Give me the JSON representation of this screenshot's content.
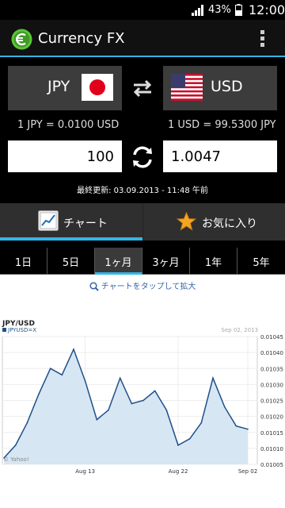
{
  "status_bar": {
    "battery_percent": "43%",
    "time": "12:00"
  },
  "action_bar": {
    "title": "Currency FX"
  },
  "converter": {
    "from_code": "JPY",
    "to_code": "USD",
    "from_rate": "1 JPY = 0.0100 USD",
    "to_rate": "1 USD = 99.5300 JPY",
    "from_amount": "100",
    "to_amount": "1.0047",
    "last_updated": "最終更新: 03.09.2013 - 11:48 午前"
  },
  "tabs": [
    {
      "label": "チャート",
      "icon": "chart-icon"
    },
    {
      "label": "お気に入り",
      "icon": "star-icon"
    }
  ],
  "periods": [
    "1日",
    "5日",
    "1ヶ月",
    "3ヶ月",
    "1年",
    "5年"
  ],
  "selected_period": "1ヶ月",
  "tap_hint": "チャートをタップして拡大",
  "chart_data": {
    "type": "area",
    "title": "JPY/USD",
    "legend": "JPYUSD=X",
    "date_label": "Sep 02, 2013",
    "watermark": "© Yahoo!",
    "x_tick_labels": [
      "Aug 13",
      "Aug 22",
      "Sep 02"
    ],
    "y_tick_labels": [
      "0.01045",
      "0.01040",
      "0.01035",
      "0.01030",
      "0.01025",
      "0.01020",
      "0.01015",
      "0.01010",
      "0.01005"
    ],
    "ylim": [
      0.01005,
      0.01045
    ],
    "x_count": 22,
    "series": [
      {
        "name": "JPYUSD=X",
        "values": [
          0.01007,
          0.01011,
          0.01018,
          0.01027,
          0.01035,
          0.01033,
          0.01041,
          0.01031,
          0.01019,
          0.01022,
          0.01032,
          0.01024,
          0.01025,
          0.01028,
          0.01022,
          0.01011,
          0.01013,
          0.01018,
          0.01032,
          0.01023,
          0.01017,
          0.01016
        ]
      }
    ],
    "colors": {
      "line": "#1f4f8a",
      "fill": "#d6e6f2"
    }
  }
}
